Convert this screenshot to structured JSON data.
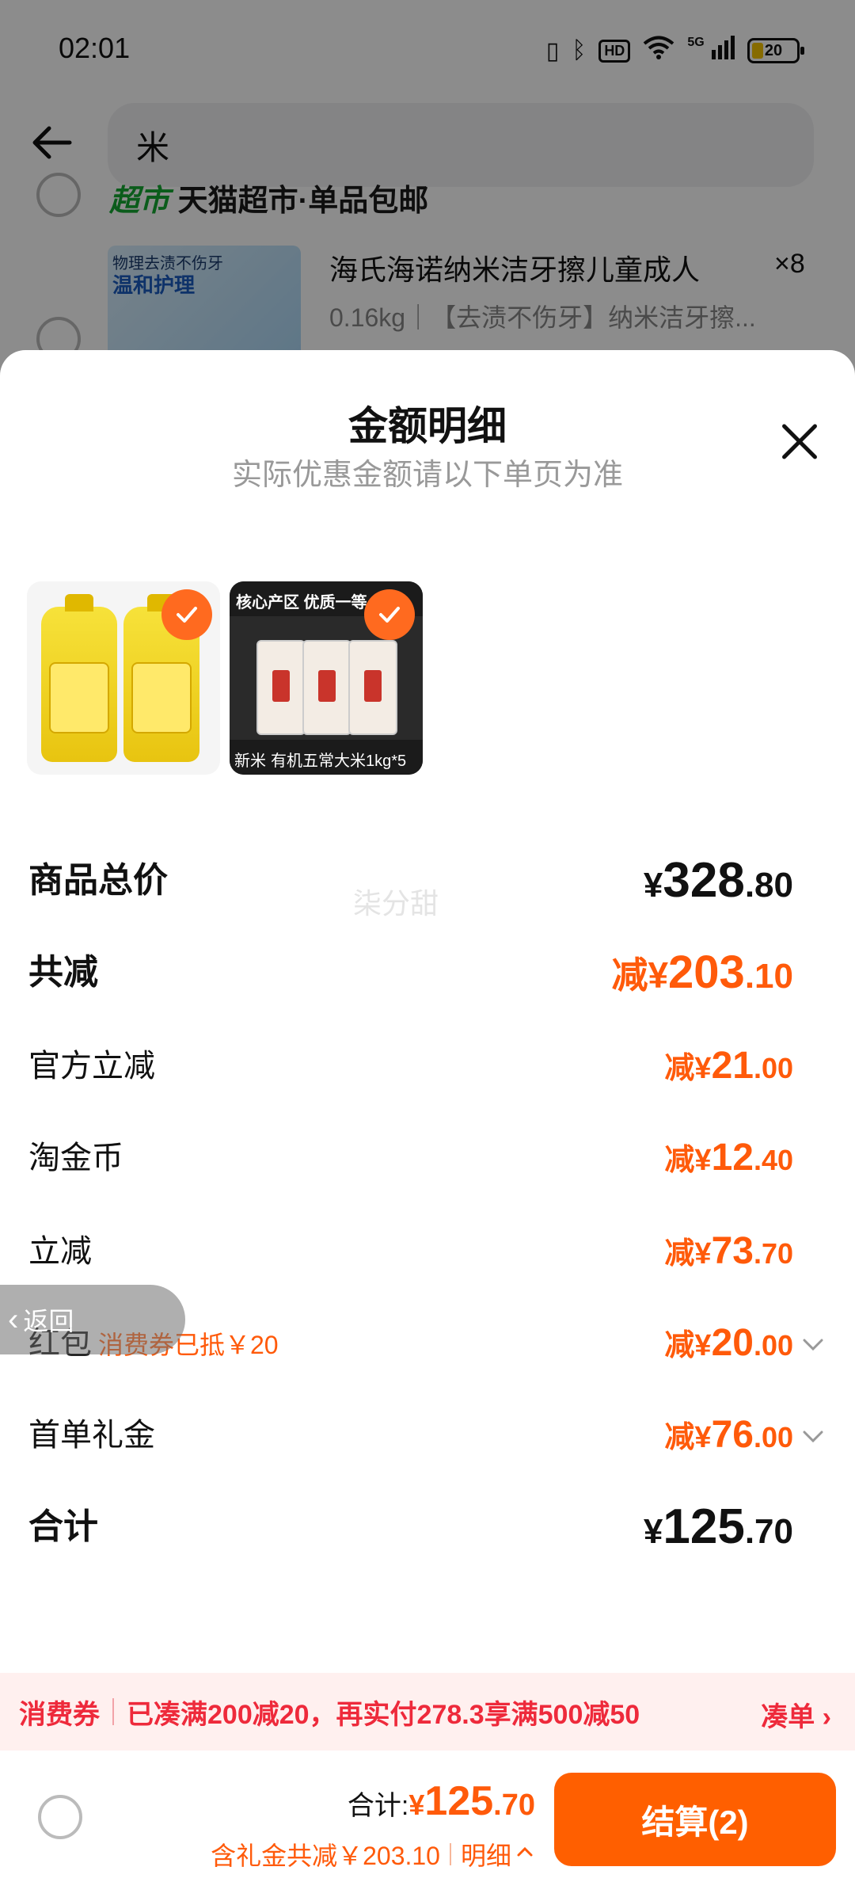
{
  "status_bar": {
    "time": "02:01",
    "hd_label": "HD",
    "network_label": "5G",
    "battery_level": "20",
    "icons": [
      "vibrate-icon",
      "bluetooth-icon",
      "hd-icon",
      "wifi-icon",
      "signal-5g-icon",
      "battery-icon"
    ]
  },
  "header": {
    "search_query": "米"
  },
  "background": {
    "shop_tag": "超市",
    "shop_title": "天猫超市·单品包邮",
    "product_name": "海氏海诺纳米洁牙擦儿童成人",
    "product_qty": "×8",
    "product_spec": "0.16kg｜【去渍不伤牙】纳米洁牙擦...",
    "product_img_text_1": "物理去渍不伤牙",
    "product_img_text_2": "温和护理"
  },
  "sheet": {
    "title": "金额明细",
    "subtitle": "实际优惠金额请以下单页为准",
    "thumbnails": [
      {
        "name": "oil",
        "selected": true
      },
      {
        "name": "rice",
        "selected": true,
        "top_text": "核心产区 优质一等",
        "bottom_text": "有机五常大米1kg*5",
        "badge_text": "新米"
      }
    ],
    "watermark": "柒分甜",
    "rows": {
      "goods_total": {
        "label": "商品总价",
        "currency": "¥",
        "int": "328",
        "dec": ".80"
      },
      "total_reduce": {
        "label": "共减",
        "prefix": "减¥",
        "int": "203",
        "dec": ".10"
      },
      "official": {
        "label": "官方立减",
        "prefix": "减¥",
        "int": "21",
        "dec": ".00"
      },
      "coins": {
        "label": "淘金币",
        "prefix": "减¥",
        "int": "12",
        "dec": ".40"
      },
      "instant": {
        "label": "立减",
        "prefix": "减¥",
        "int": "73",
        "dec": ".70"
      },
      "red_packet": {
        "label": "红包",
        "note": "消费券已抵￥20",
        "prefix": "减¥",
        "int": "20",
        "dec": ".00"
      },
      "first_order": {
        "label": "首单礼金",
        "prefix": "减¥",
        "int": "76",
        "dec": ".00"
      },
      "sum": {
        "label": "合计",
        "currency": "¥",
        "int": "125",
        "dec": ".70"
      }
    },
    "float_back_label": "返回"
  },
  "coupon_banner": {
    "tag": "消费券",
    "text": "已凑满200减20，再实付278.3享满500减50",
    "link": "凑单"
  },
  "checkout": {
    "total_label": "合计:",
    "currency": "¥",
    "int": "125",
    "dec": ".70",
    "discount_text": "含礼金共减￥203.10",
    "detail_label": "明细",
    "button_label": "结算(2)"
  },
  "colors": {
    "accent_orange": "#ff5f00",
    "discount_orange": "#ff5a0a",
    "coupon_red": "#ee2a3b",
    "coupon_bg": "#fff0ef"
  }
}
